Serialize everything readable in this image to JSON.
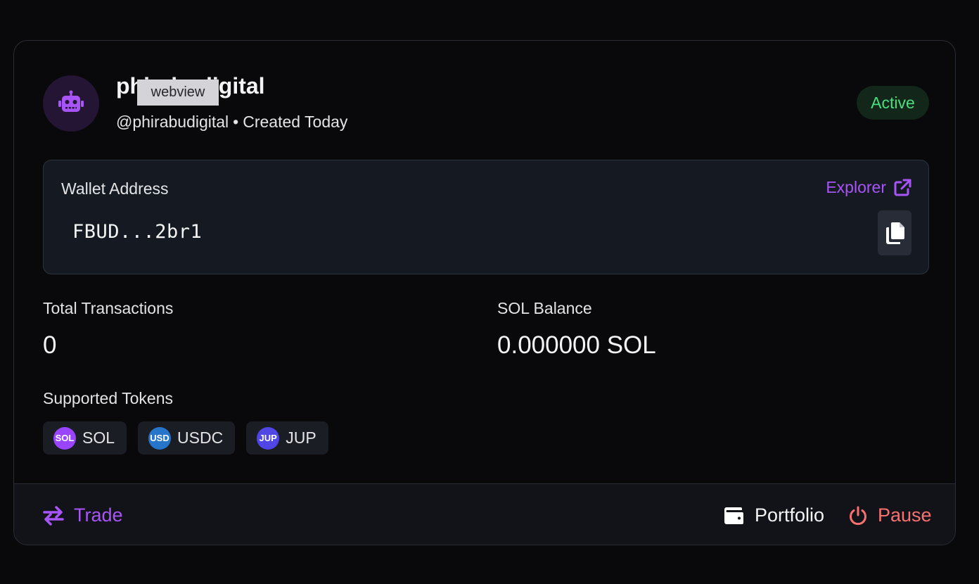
{
  "header": {
    "bot_name": "phirabudigital",
    "tooltip": "webview",
    "handle": "@phirabudigital",
    "separator": "•",
    "created": "Created Today",
    "status": "Active",
    "avatar_icon": "robot-icon"
  },
  "wallet": {
    "label": "Wallet Address",
    "explorer_label": "Explorer",
    "address": "FBUD...2br1",
    "explorer_icon": "external-link-icon",
    "copy_icon": "copy-icon"
  },
  "stats": {
    "transactions_label": "Total Transactions",
    "transactions_value": "0",
    "balance_label": "SOL Balance",
    "balance_value": "0.000000 SOL"
  },
  "tokens": {
    "label": "Supported Tokens",
    "items": [
      {
        "symbol": "SOL",
        "badge": "SOL",
        "color": "#9945ff"
      },
      {
        "symbol": "USDC",
        "badge": "USD",
        "color": "#2775ca"
      },
      {
        "symbol": "JUP",
        "badge": "JUP",
        "color": "#4f46e5"
      }
    ]
  },
  "footer": {
    "trade_label": "Trade",
    "portfolio_label": "Portfolio",
    "pause_label": "Pause"
  },
  "colors": {
    "accent": "#a855f7",
    "active": "#4ade80",
    "pause": "#f87171"
  }
}
